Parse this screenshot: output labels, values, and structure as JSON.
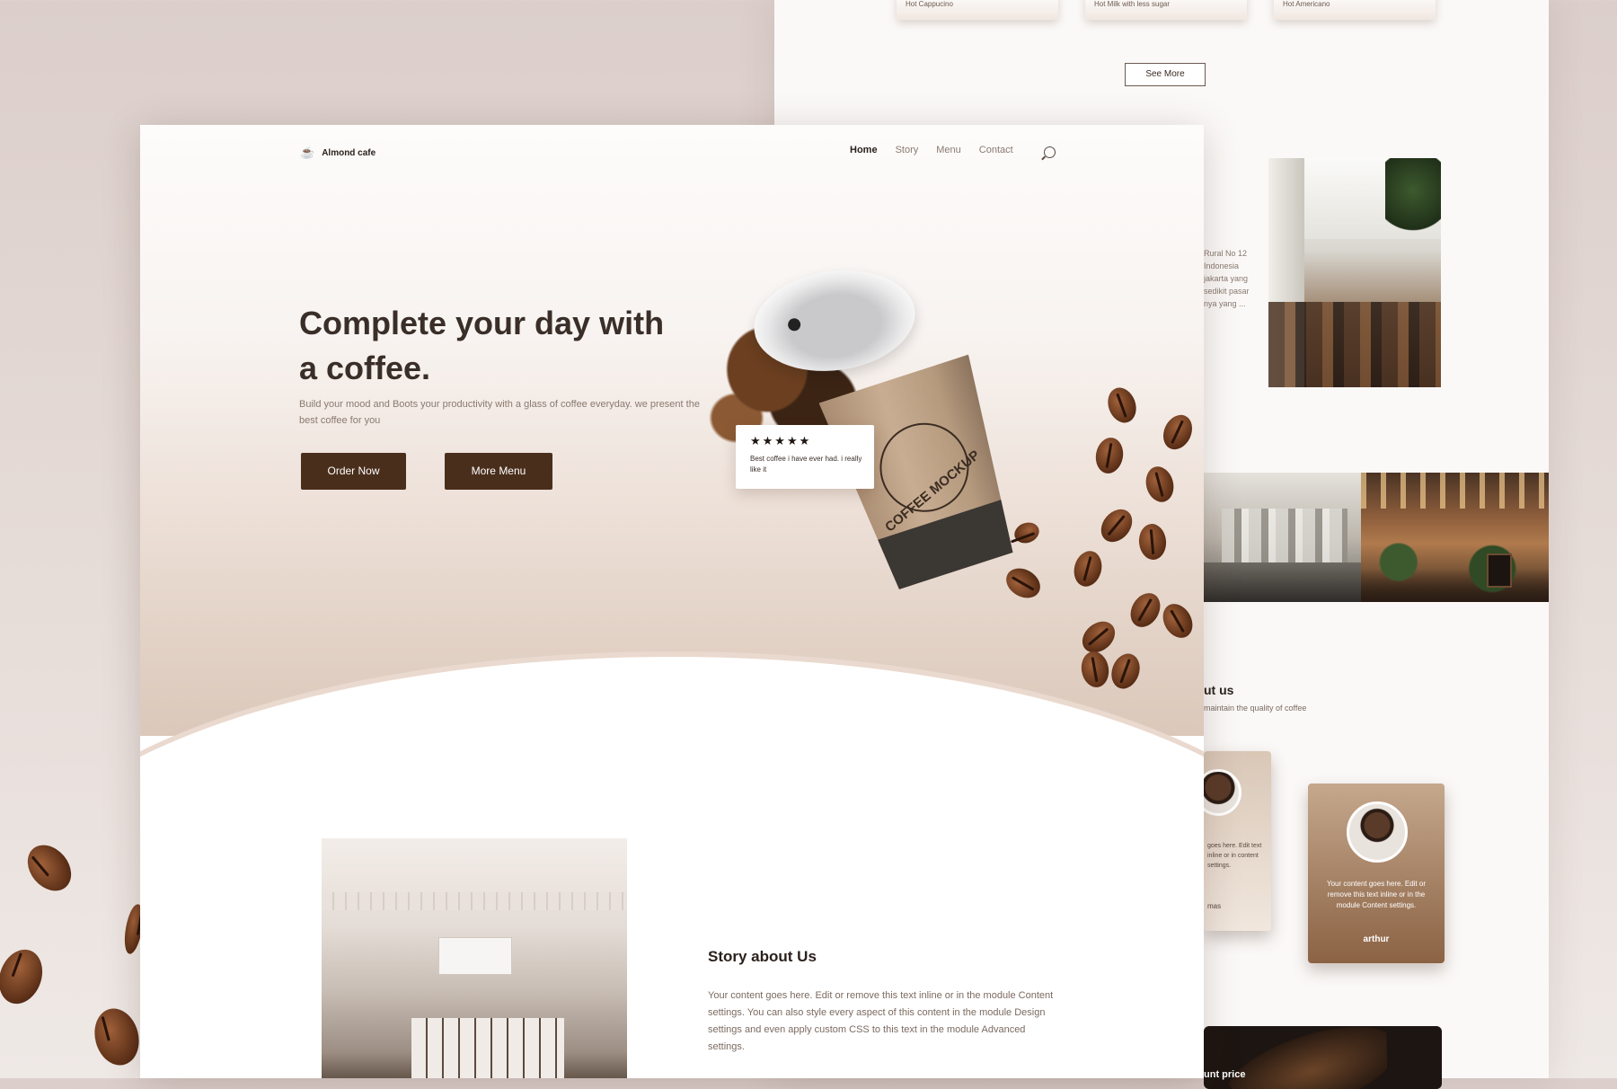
{
  "back": {
    "menu_cards": [
      "Hot Cappucino",
      "Hot Milk with less sugar",
      "Hot Americano"
    ],
    "see_more": "See More",
    "story_snippet": "Rural No 12\nIndonesia\njakarta yang\nsedikit pasar\nnya yang ...",
    "about_title": "ut us",
    "about_sub": "maintain the quality of coffee",
    "testimonials": [
      {
        "text": "goes here. Edit text inline or in content settings.",
        "name": "mas"
      },
      {
        "text": "Your content goes here. Edit or remove this text inline or in the module Content settings.",
        "name": "arthur"
      }
    ],
    "price_label": "unt price"
  },
  "front": {
    "brand": "Almond cafe",
    "nav": [
      "Home",
      "Story",
      "Menu",
      "Contact"
    ],
    "headline": "Complete your day with a coffee.",
    "subline": "Build your mood and Boots your productivity with a glass of coffee everyday. we present the best coffee for you",
    "buttons": {
      "order": "Order Now",
      "menu": "More Menu"
    },
    "cup_text": "COFFEE MOCKUP",
    "review": {
      "stars": "★★★★★",
      "text": "Best coffee i have ever had. i really like it"
    },
    "story": {
      "title": "Story about Us",
      "body": "Your content goes here. Edit or remove this text inline or in the module Content settings. You can also style every aspect of this content in the module Design settings and even apply custom CSS to this text in the module Advanced settings."
    }
  },
  "colors": {
    "brand_brown": "#4a2e1c",
    "page_bg": "#dccfcb",
    "text_dark": "#2b211c"
  }
}
